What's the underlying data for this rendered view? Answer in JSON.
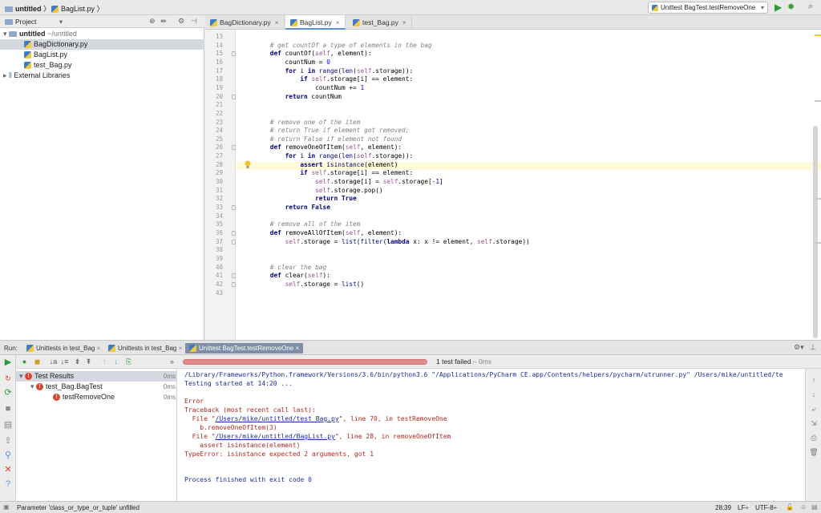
{
  "navbar": {
    "project": "untitled",
    "file": "BagList.py",
    "run_config": "Unittest BagTest.testRemoveOne"
  },
  "project_panel": {
    "title": "Project",
    "root_name": "untitled",
    "root_path": "~/untitled",
    "files": [
      "BagDictionary.py",
      "BagList.py",
      "test_Bag.py"
    ],
    "external": "External Libraries"
  },
  "editor_tabs": [
    {
      "label": "BagDictionary.py"
    },
    {
      "label": "BagList.py"
    },
    {
      "label": "test_Bag.py"
    }
  ],
  "editor": {
    "line_numbers": [
      "13",
      "14",
      "15",
      "16",
      "17",
      "18",
      "19",
      "20",
      "21",
      "22",
      "23",
      "24",
      "25",
      "26",
      "27",
      "28",
      "29",
      "30",
      "31",
      "32",
      "33",
      "34",
      "35",
      "36",
      "37",
      "38",
      "39",
      "40",
      "41",
      "42",
      "43"
    ],
    "lines": [
      "",
      "    # get countOf a type of elements in the bag",
      "    def countOf(self, element):",
      "        countNum = 0",
      "        for i in range(len(self.storage)):",
      "            if self.storage[i] == element:",
      "                countNum += 1",
      "        return countNum",
      "",
      "",
      "    # remove one of the item",
      "    # return True if element got removed;",
      "    # return False if element not found",
      "    def removeOneOfItem(self, element):",
      "        for i in range(len(self.storage)):",
      "            assert isinstance(element)",
      "            if self.storage[i] == element:",
      "                self.storage[i] = self.storage[-1]",
      "                self.storage.pop()",
      "                return True",
      "        return False",
      "",
      "    # remove all of the item",
      "    def removeAllOfItem(self, element):",
      "        self.storage = list(filter(lambda x: x != element, self.storage))",
      "",
      "",
      "    # clear the bag",
      "    def clear(self):",
      "        self.storage = list()",
      ""
    ]
  },
  "run": {
    "label": "Run:",
    "tabs": [
      "Unittests in test_Bag",
      "Unittests in test_Bag",
      "Unittest BagTest.testRemoveOne"
    ],
    "status": "1 test failed",
    "status_time": "– 0ms",
    "progress": 1.0,
    "tree": [
      {
        "label": "Test Results",
        "time": "0ms"
      },
      {
        "label": "test_Bag.BagTest",
        "time": "0ms"
      },
      {
        "label": "testRemoveOne",
        "time": "0ms"
      }
    ],
    "console": {
      "cmd": "/Library/Frameworks/Python.framework/Versions/3.6/bin/python3.6 \"/Applications/PyCharm CE.app/Contents/helpers/pycharm/utrunner.py\" /Users/mike/untitled/te",
      "started": "Testing started at 14:20 ...",
      "error": "Error",
      "traceback": "Traceback (most recent call last):",
      "file1_prefix": "  File \"",
      "file1_link": "/Users/mike/untitled/test_Bag.py",
      "file1_suffix": "\", line 70, in testRemoveOne",
      "call1": "    b.removeOneOfItem(3)",
      "file2_prefix": "  File \"",
      "file2_link": "/Users/mike/untitled/BagList.py",
      "file2_suffix": "\", line 28, in removeOneOfItem",
      "call2": "    assert isinstance(element)",
      "type_error": "TypeError: isinstance expected 2 arguments, got 1",
      "finished": "Process finished with exit code 0"
    }
  },
  "statusbar": {
    "message": "Parameter 'class_or_type_or_tuple' unfilled",
    "position": "28:39",
    "line_sep": "LF÷",
    "encoding": "UTF-8÷"
  }
}
